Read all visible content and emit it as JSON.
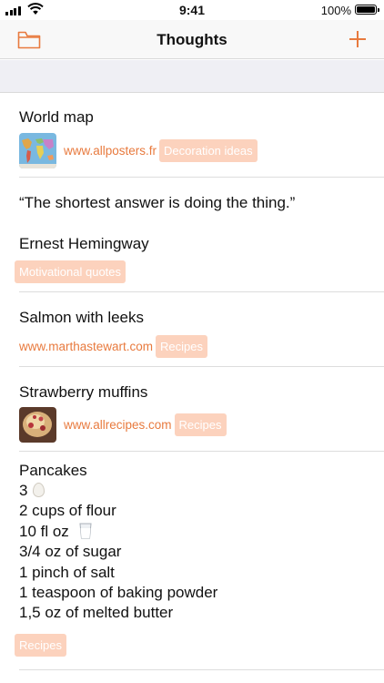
{
  "status": {
    "time": "9:41",
    "battery": "100%"
  },
  "nav": {
    "title": "Thoughts",
    "left_icon": "folder-icon",
    "right_icon": "plus-icon"
  },
  "accent": "#e87a3e",
  "tag_color": "#fcd2bd",
  "notes": [
    {
      "title": "World map",
      "thumb": "world-map-thumbnail",
      "url": "www.allposters.fr",
      "tag": "Decoration ideas"
    },
    {
      "quote": "“The shortest answer is doing the thing.”",
      "author": "Ernest Hemingway",
      "tag": "Motivational quotes"
    },
    {
      "title": "Salmon with leeks",
      "url": "www.marthastewart.com",
      "tag": "Recipes"
    },
    {
      "title": "Strawberry muffins",
      "thumb": "muffin-thumbnail",
      "url": "www.allrecipes.com",
      "tag": "Recipes"
    },
    {
      "title": "Pancakes",
      "lines": [
        "3",
        "2 cups of flour",
        "10 fl oz",
        "3/4 oz of sugar",
        "1 pinch of salt",
        "1 teaspoon of baking powder",
        "1,5 oz of melted butter"
      ],
      "tag": "Recipes"
    }
  ]
}
